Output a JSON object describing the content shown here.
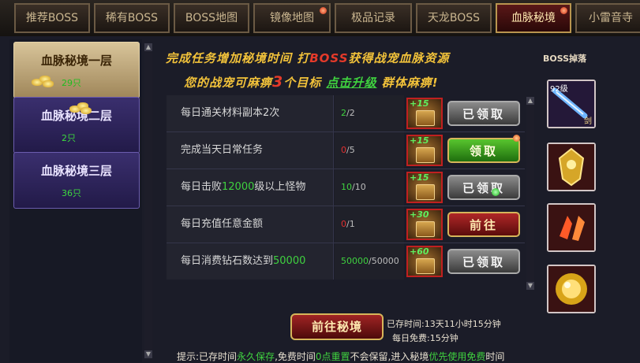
{
  "tabs": [
    {
      "label": "推荐BOSS",
      "active": false,
      "dot": false
    },
    {
      "label": "稀有BOSS",
      "active": false,
      "dot": false
    },
    {
      "label": "BOSS地图",
      "active": false,
      "dot": false
    },
    {
      "label": "镜像地图",
      "active": false,
      "dot": true
    },
    {
      "label": "极品记录",
      "active": false,
      "dot": false
    },
    {
      "label": "天龙BOSS",
      "active": false,
      "dot": false
    },
    {
      "label": "血脉秘境",
      "active": true,
      "dot": true
    },
    {
      "label": "小雷音寺",
      "active": false,
      "dot": false
    }
  ],
  "floors": [
    {
      "name": "血脉秘境一层",
      "count": "29只",
      "active": true
    },
    {
      "name": "血脉秘境二层",
      "count": "2只",
      "active": false
    },
    {
      "name": "血脉秘境三层",
      "count": "36只",
      "active": false
    }
  ],
  "header": {
    "line1_a": "完成任务增加秘境时间 打",
    "line1_boss": "BOSS",
    "line1_b": "获得战宠血脉资源",
    "line2_a": "您的战宠可麻痹",
    "line2_num": "3",
    "line2_b": "个目标",
    "line2_click": "点击升级",
    "line2_c": "群体麻痹!",
    "drop_label": "BOSS掉落"
  },
  "tasks": [
    {
      "text": "每日通关材料副本2次",
      "hl": "",
      "text_after": "",
      "current": "2",
      "total": "/2",
      "cur_red": false,
      "reward": "+15",
      "button": "已领取",
      "btn_style": "grey"
    },
    {
      "text": "完成当天日常任务",
      "hl": "",
      "text_after": "",
      "current": "0",
      "total": "/5",
      "cur_red": true,
      "reward": "+15",
      "button": "领取",
      "btn_style": "green"
    },
    {
      "text": "每日击败",
      "hl": "12000",
      "text_after": "级以上怪物",
      "current": "10",
      "total": "/10",
      "cur_red": false,
      "reward": "+15",
      "button": "已领取",
      "btn_style": "grey"
    },
    {
      "text": "每日充值任意金额",
      "hl": "",
      "text_after": "",
      "current": "0",
      "total": "/1",
      "cur_red": true,
      "reward": "+30",
      "button": "前往",
      "btn_style": "red"
    },
    {
      "text": "每日消费钻石数达到",
      "hl": "50000",
      "text_after": "",
      "current": "50000",
      "total": "/50000",
      "cur_red": false,
      "reward": "+60",
      "button": "已领取",
      "btn_style": "grey"
    }
  ],
  "drops": [
    {
      "icon": "sword-icon",
      "level": "92级",
      "tag": "剑"
    },
    {
      "icon": "gold-armor-icon",
      "level": "",
      "tag": ""
    },
    {
      "icon": "red-crystal-icon",
      "level": "",
      "tag": ""
    },
    {
      "icon": "gold-orb-icon",
      "level": "",
      "tag": ""
    }
  ],
  "footer": {
    "go_button": "前往秘境",
    "saved_time": "已存时间:13天11小时15分钟",
    "free_time": "每日免费:15分钟",
    "tip_a": "提示:已存时间",
    "tip_g1": "永久保存",
    "tip_b": ",免费时间",
    "tip_g2": "0点重置",
    "tip_c": "不会保留,进入秘境",
    "tip_g3": "优先使用免费",
    "tip_d": "时间"
  },
  "colors": {
    "accent_gold": "#f2c23a",
    "highlight_green": "#3fd13f",
    "alert_red": "#e53a2a"
  }
}
